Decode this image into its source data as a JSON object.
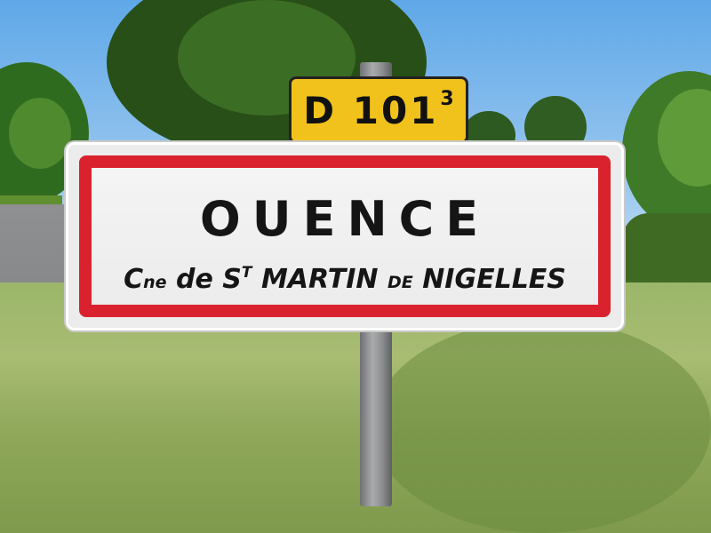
{
  "route_plate": {
    "main": "D 101",
    "superscript": "3"
  },
  "town_sign": {
    "town_name": "OUENCE",
    "commune_line": {
      "c": "C",
      "ne": "ne",
      "de1": "de",
      "s": "S",
      "t": "T",
      "martin": "MARTIN",
      "de2": "DE",
      "nigelles": "NIGELLES"
    }
  },
  "colors": {
    "sign_border_red": "#d9222d",
    "route_plate_yellow": "#f1c21b",
    "sky": "#8ec0ec"
  }
}
